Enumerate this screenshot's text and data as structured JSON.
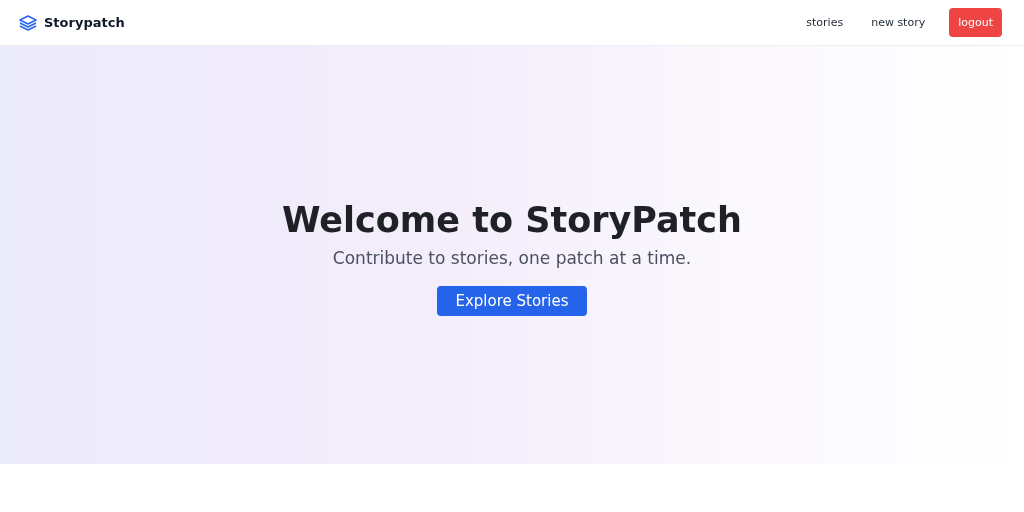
{
  "navbar": {
    "brand": "Storypatch",
    "links": [
      {
        "label": "stories",
        "kind": "link"
      },
      {
        "label": "new story",
        "kind": "link"
      },
      {
        "label": "logout",
        "kind": "danger"
      }
    ]
  },
  "hero": {
    "title": "Welcome to StoryPatch",
    "subtitle": "Contribute to stories, one patch at a time.",
    "button": "Explore Stories"
  }
}
